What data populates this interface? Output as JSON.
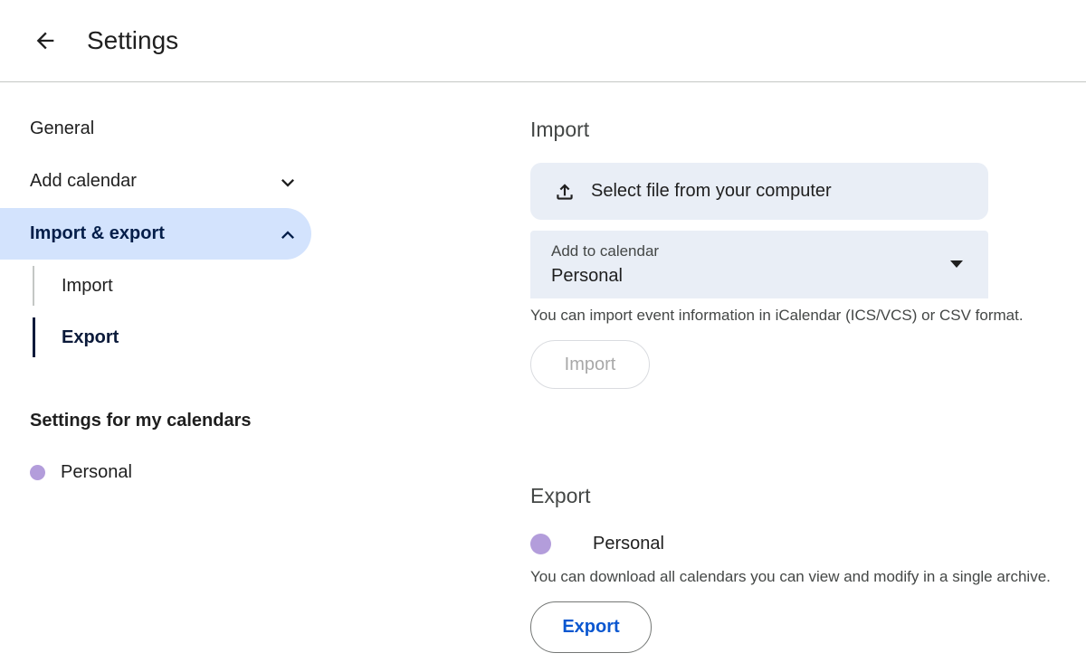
{
  "header": {
    "title": "Settings",
    "back_icon": "arrow-back-icon"
  },
  "sidebar": {
    "items": [
      {
        "label": "General"
      },
      {
        "label": "Add calendar",
        "icon": "chevron-down-icon"
      },
      {
        "label": "Import & export",
        "icon": "chevron-up-icon",
        "active": true
      }
    ],
    "sub_items": [
      {
        "label": "Import"
      },
      {
        "label": "Export",
        "selected": true
      }
    ],
    "calendars_heading": "Settings for my calendars",
    "calendars": [
      {
        "label": "Personal",
        "color": "#b39ddb"
      }
    ]
  },
  "import": {
    "heading": "Import",
    "file_button": "Select file from your computer",
    "file_icon": "upload-icon",
    "select": {
      "label": "Add to calendar",
      "value": "Personal",
      "icon": "dropdown-arrow-icon"
    },
    "help": "You can import event information in iCalendar (ICS/VCS) or CSV format.",
    "button": "Import"
  },
  "export": {
    "heading": "Export",
    "calendar": {
      "label": "Personal",
      "color": "#b39ddb"
    },
    "help": "You can download all calendars you can view and modify in a single archive.",
    "button": "Export"
  },
  "colors": {
    "active_bg": "#d3e3fd",
    "field_bg": "#e9eef6",
    "accent": "#0b57d0",
    "calendar_personal": "#b39ddb"
  }
}
